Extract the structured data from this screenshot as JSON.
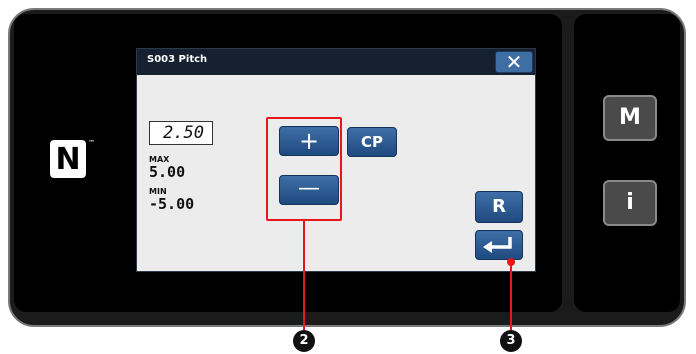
{
  "nfc": {
    "symbol": "N",
    "tm": "™"
  },
  "dialog": {
    "title": "S003 Pitch",
    "close_label": "✕",
    "value": "2.50",
    "max_label": "MAX",
    "max_value": "5.00",
    "min_label": "MIN",
    "min_value": "-5.00"
  },
  "buttons": {
    "plus": "+",
    "minus": "—",
    "cp": "CP",
    "r": "R",
    "enter_icon": "enter-arrow-icon"
  },
  "side": {
    "m": "M",
    "i": "i"
  },
  "callouts": {
    "two": "2",
    "three": "3"
  },
  "colors": {
    "device_bg": "#1b1b1b",
    "dialog_titlebar": "#152030",
    "button_blue": "#2f5d95",
    "highlight_red": "#e8161c"
  }
}
